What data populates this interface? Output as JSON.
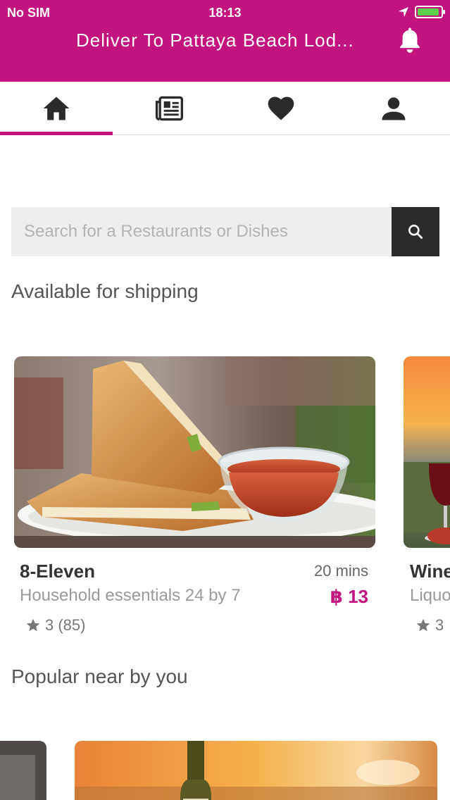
{
  "status_bar": {
    "carrier": "No SIM",
    "time": "18:13"
  },
  "header": {
    "deliver_text": "Deliver To Pattaya Beach Lod...",
    "accent_color": "#c2137f"
  },
  "tabs": [
    {
      "icon": "home-icon",
      "active": true
    },
    {
      "icon": "news-icon",
      "active": false
    },
    {
      "icon": "heart-icon",
      "active": false
    },
    {
      "icon": "user-icon",
      "active": false
    }
  ],
  "search": {
    "placeholder": "Search for a Restaurants or Dishes"
  },
  "sections": {
    "available": "Available for shipping",
    "popular": "Popular near by you"
  },
  "restaurants": [
    {
      "name": "8-Eleven",
      "description": "Household essentials 24 by 7",
      "time": "20 mins",
      "price": "฿ 13",
      "rating": "3 (85)"
    },
    {
      "name": "Wine",
      "description": "Liquo",
      "rating": "3"
    }
  ]
}
